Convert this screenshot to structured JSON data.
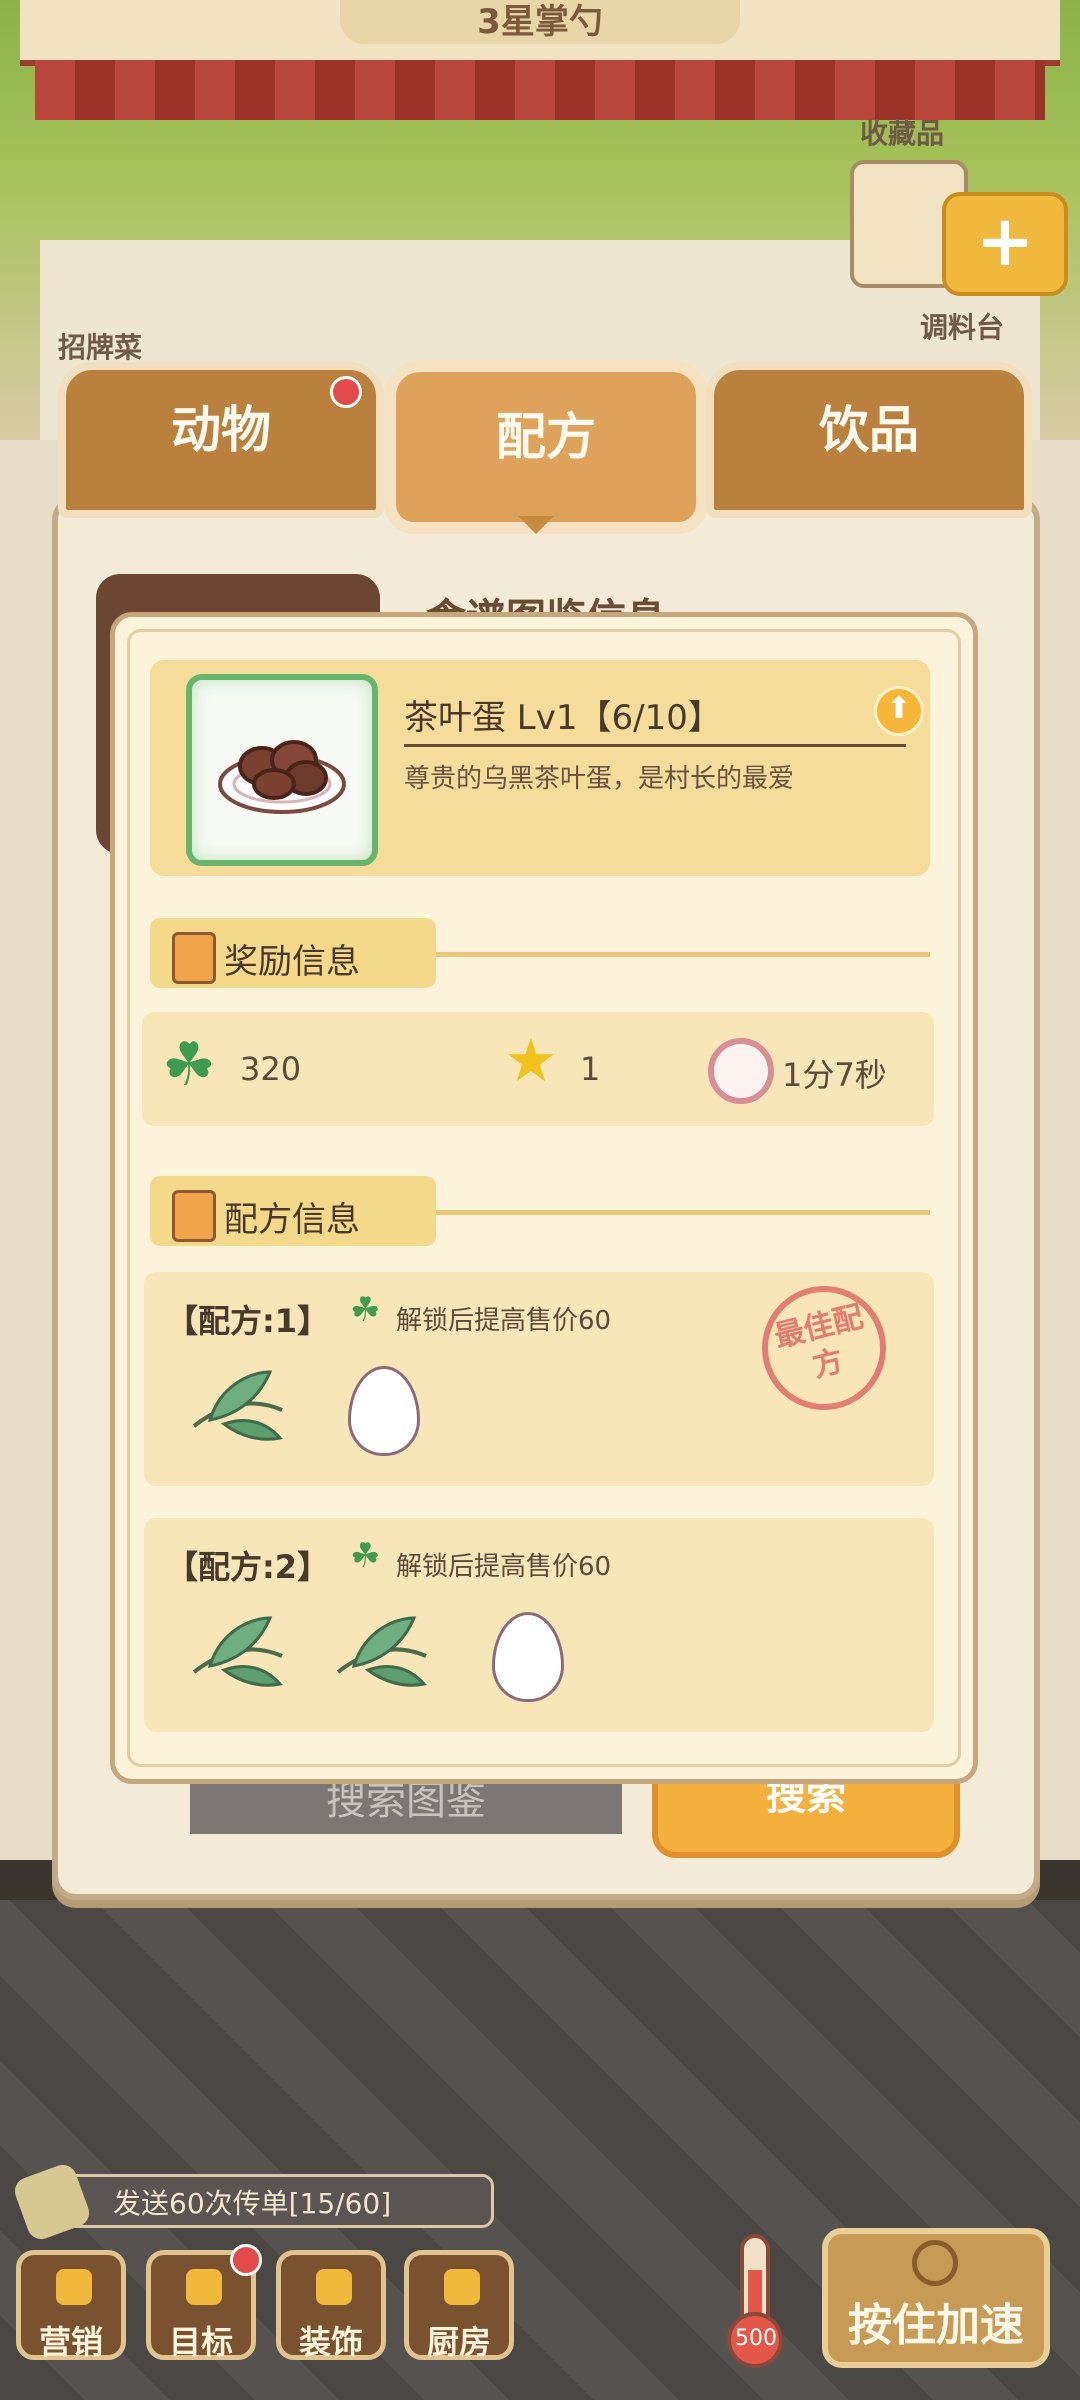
{
  "scene": {
    "shop_sign": "3星掌勺",
    "collection_label": "收藏品",
    "seasoning_label": "调料台",
    "signature_dish_label": "招牌菜"
  },
  "tabs": [
    {
      "label": "动物",
      "has_badge": true
    },
    {
      "label": "配方",
      "selected": true
    },
    {
      "label": "饮品"
    }
  ],
  "panel": {
    "title": "食谱图鉴信息",
    "search_placeholder": "搜索图鉴",
    "search_button": "搜索"
  },
  "item": {
    "name": "茶叶蛋 Lv1【6/10】",
    "description": "尊贵的乌黑茶叶蛋，是村长的最爱",
    "icon": "tea-egg-plate"
  },
  "reward_section": {
    "title": "奖励信息",
    "clover_value": "320",
    "star_value": "1",
    "time_value": "1分7秒"
  },
  "recipe_section": {
    "title": "配方信息",
    "recipes": [
      {
        "title": "【配方:1】",
        "note": "解锁后提高售价60",
        "stamp": "最佳配方",
        "ingredients": [
          "tea-leaf",
          "egg"
        ]
      },
      {
        "title": "【配方:2】",
        "note": "解锁后提高售价60",
        "ingredients": [
          "tea-leaf",
          "tea-leaf",
          "egg"
        ]
      }
    ]
  },
  "bottom": {
    "quest": "发送60次传单[15/60]",
    "buttons": [
      "营销",
      "目标",
      "装饰",
      "厨房"
    ],
    "target_has_badge": true,
    "thermometer_value": "500",
    "speed_button": "按住加速"
  },
  "colors": {
    "tab_brown": "#b9803e",
    "modal_bg": "#fdf3da",
    "card_yellow": "#f6dc9b",
    "clover_green": "#3f9b4d",
    "stamp_red": "#e0736a"
  }
}
